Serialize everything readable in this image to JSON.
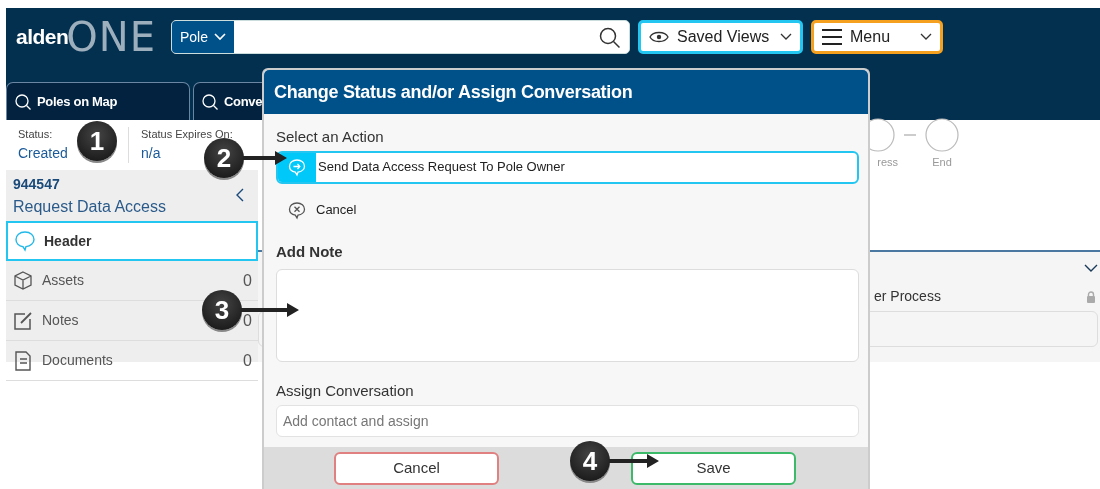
{
  "header": {
    "logo_text": "alden",
    "logo_mark": "ONE",
    "search_scope": "Pole",
    "saved_views": "Saved Views",
    "menu": "Menu"
  },
  "tabs": [
    {
      "label": "Poles on Map"
    },
    {
      "label": "Conve"
    }
  ],
  "status": [
    {
      "label": "Status:",
      "value": "Created"
    },
    {
      "label": "Status Expires On:",
      "value": "n/a"
    }
  ],
  "progress": [
    {
      "label": "ress"
    },
    {
      "label": "End"
    }
  ],
  "record": {
    "id": "944547",
    "title": "Request Data Access"
  },
  "sidebar": {
    "items": [
      {
        "label": "Header",
        "kind": "header",
        "selected": true
      },
      {
        "label": "Assets",
        "kind": "assets",
        "count": "0",
        "selected": false
      },
      {
        "label": "Notes",
        "kind": "notes",
        "count": "0",
        "selected": false
      },
      {
        "label": "Documents",
        "kind": "documents",
        "count": "0",
        "selected": false
      }
    ]
  },
  "panel": {
    "field_label": "er Process",
    "locked": true
  },
  "dialog": {
    "title": "Change Status and/or Assign Conversation",
    "action_label": "Select an Action",
    "actions": [
      {
        "label": "Send Data Access Request To Pole Owner",
        "kind": "send",
        "selected": true
      },
      {
        "label": "Cancel",
        "kind": "cancel",
        "selected": false
      }
    ],
    "note_label": "Add Note",
    "assign_label": "Assign Conversation",
    "assign_placeholder": "Add contact and assign",
    "buttons": [
      {
        "label": "Cancel",
        "kind": "cancel"
      },
      {
        "label": "Save",
        "kind": "save"
      }
    ]
  },
  "callouts": [
    {
      "number": "1",
      "arrow": false
    },
    {
      "number": "2",
      "arrow": true
    },
    {
      "number": "3",
      "arrow": true
    },
    {
      "number": "4",
      "arrow": true
    }
  ]
}
